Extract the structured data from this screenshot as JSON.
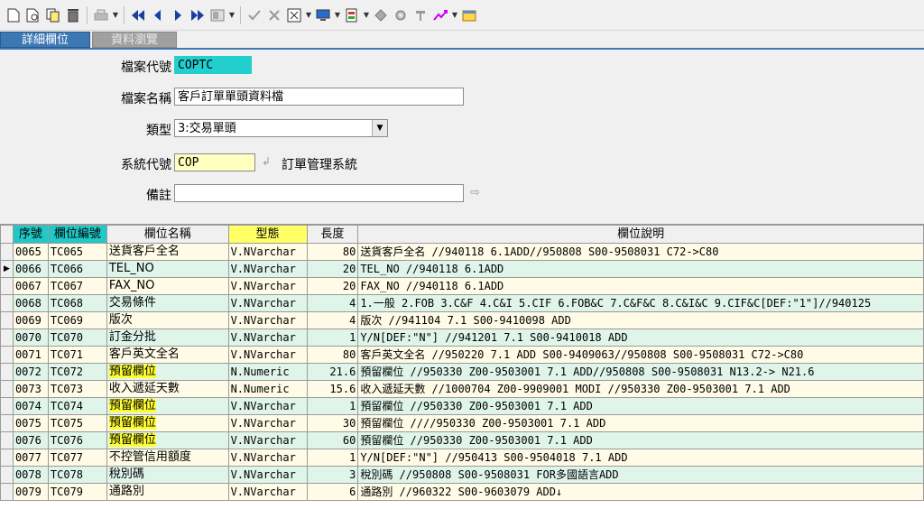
{
  "toolbar": {
    "icons": [
      "new-icon",
      "preview-icon",
      "copy-icon",
      "delete-icon",
      "print-icon",
      "first-icon",
      "prev-icon",
      "next-icon",
      "last-icon",
      "view-icon",
      "confirm-icon",
      "cancel-icon",
      "query-icon",
      "screen-icon",
      "report-icon",
      "tools-icon",
      "settings-icon",
      "chart-icon",
      "exit-icon"
    ]
  },
  "tabs": {
    "detail": "詳細欄位",
    "browse": "資料瀏覽"
  },
  "form": {
    "file_code_label": "檔案代號",
    "file_code": "COPTC",
    "file_name_label": "檔案名稱",
    "file_name": "客戶訂單單頭資料檔",
    "type_label": "類型",
    "type_value": "3:交易單頭",
    "system_code_label": "系統代號",
    "system_code": "COP",
    "system_name": "訂單管理系統",
    "note_label": "備註",
    "note": ""
  },
  "grid": {
    "headers": {
      "seq": "序號",
      "field_no": "欄位編號",
      "field_name": "欄位名稱",
      "type": "型態",
      "length": "長度",
      "desc": "欄位說明"
    },
    "rows": [
      {
        "seq": "0065",
        "code": "TC065",
        "name": "送貨客戶全名",
        "type": "V.NVarchar",
        "len": "80",
        "desc": "送貨客戶全名    //940118 6.1ADD//950808 S00-9508031 C72->C80"
      },
      {
        "seq": "0066",
        "code": "TC066",
        "name": "TEL_NO",
        "type": "V.NVarchar",
        "len": "20",
        "desc": "TEL_NO          //940118 6.1ADD"
      },
      {
        "seq": "0067",
        "code": "TC067",
        "name": "FAX_NO",
        "type": "V.NVarchar",
        "len": "20",
        "desc": "FAX_NO          //940118 6.1ADD"
      },
      {
        "seq": "0068",
        "code": "TC068",
        "name": "交易條件",
        "type": "V.NVarchar",
        "len": "4",
        "desc": "1.一般 2.FOB 3.C&F 4.C&I 5.CIF 6.FOB&C 7.C&F&C 8.C&I&C 9.CIF&C[DEF:\"1\"]//940125"
      },
      {
        "seq": "0069",
        "code": "TC069",
        "name": "版次",
        "type": "V.NVarchar",
        "len": "4",
        "desc": "版次            //941104 7.1 S00-9410098 ADD"
      },
      {
        "seq": "0070",
        "code": "TC070",
        "name": "訂金分批",
        "type": "V.NVarchar",
        "len": "1",
        "desc": "Y/N[DEF:\"N\"]         //941201 7.1 S00-9410018 ADD"
      },
      {
        "seq": "0071",
        "code": "TC071",
        "name": "客戶英文全名",
        "type": "V.NVarchar",
        "len": "80",
        "desc": "客戶英文全名          //950220 7.1 ADD S00-9409063//950808 S00-9508031 C72->C80"
      },
      {
        "seq": "0072",
        "code": "TC072",
        "name": "預留欄位",
        "type": "N.Numeric",
        "len": "21.6",
        "desc": "預留欄位 //950330 Z00-9503001 7.1 ADD//950808 S00-9508031 N13.2-> N21.6",
        "hl": true
      },
      {
        "seq": "0073",
        "code": "TC073",
        "name": "收入遞延天數",
        "type": "N.Numeric",
        "len": "15.6",
        "desc": "收入遞延天數        //1000704 Z00-9909001 MODI //950330 Z00-9503001 7.1 ADD"
      },
      {
        "seq": "0074",
        "code": "TC074",
        "name": "預留欄位",
        "type": "V.NVarchar",
        "len": "1",
        "desc": "預留欄位 //950330 Z00-9503001 7.1 ADD",
        "hl": true
      },
      {
        "seq": "0075",
        "code": "TC075",
        "name": "預留欄位",
        "type": "V.NVarchar",
        "len": "30",
        "desc": "預留欄位 ////950330 Z00-9503001 7.1 ADD",
        "hl": true
      },
      {
        "seq": "0076",
        "code": "TC076",
        "name": "預留欄位",
        "type": "V.NVarchar",
        "len": "60",
        "desc": "預留欄位 //950330 Z00-9503001 7.1 ADD",
        "hl": true
      },
      {
        "seq": "0077",
        "code": "TC077",
        "name": "不控管信用額度",
        "type": "V.NVarchar",
        "len": "1",
        "desc": "Y/N[DEF:\"N\"]  //950413 S00-9504018 7.1 ADD"
      },
      {
        "seq": "0078",
        "code": "TC078",
        "name": "稅別碼",
        "type": "V.NVarchar",
        "len": "3",
        "desc": "稅別碼   //950808 S00-9508031 FOR多國語言ADD"
      },
      {
        "seq": "0079",
        "code": "TC079",
        "name": "通路別",
        "type": "V.NVarchar",
        "len": "6",
        "desc": "通路別    //960322 S00-9603079 ADD↓"
      }
    ],
    "current_row": "0066"
  }
}
